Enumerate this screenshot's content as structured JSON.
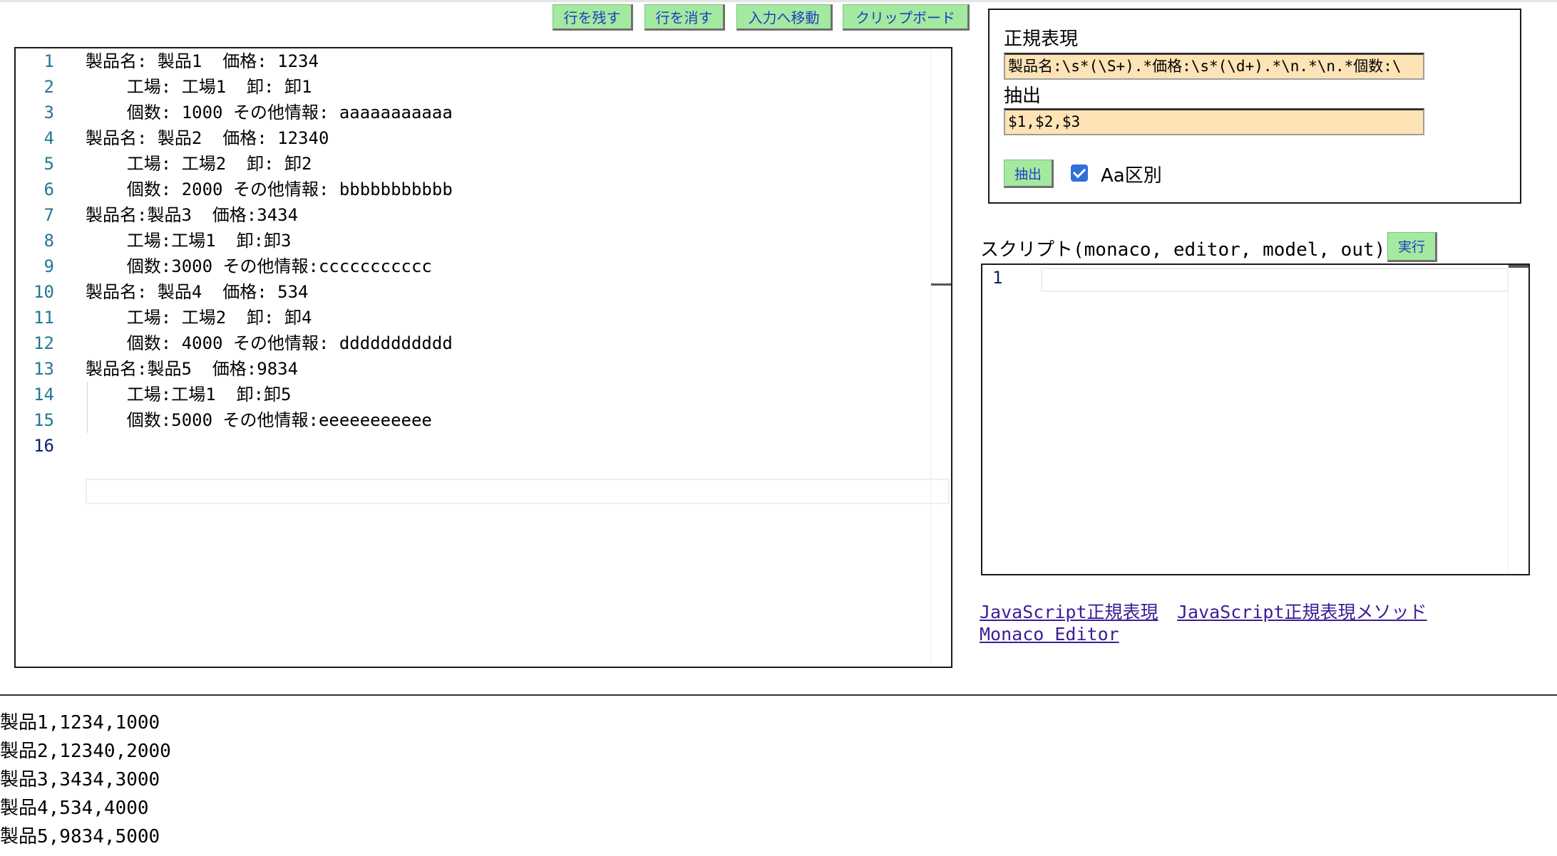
{
  "toolbar": {
    "keep_lines": "行を残す",
    "delete_lines": "行を消す",
    "move_to_input": "入力へ移動",
    "clipboard": "クリップボード"
  },
  "editor": {
    "lines": [
      {
        "num": "1",
        "text": "製品名: 製品1  価格: 1234"
      },
      {
        "num": "2",
        "text": "    工場: 工場1  卸: 卸1"
      },
      {
        "num": "3",
        "text": "    個数: 1000 その他情報: aaaaaaaaaaa"
      },
      {
        "num": "4",
        "text": "製品名: 製品2  価格: 12340"
      },
      {
        "num": "5",
        "text": "    工場: 工場2  卸: 卸2"
      },
      {
        "num": "6",
        "text": "    個数: 2000 その他情報: bbbbbbbbbbb"
      },
      {
        "num": "7",
        "text": "製品名:製品3  価格:3434"
      },
      {
        "num": "8",
        "text": "    工場:工場1  卸:卸3"
      },
      {
        "num": "9",
        "text": "    個数:3000 その他情報:ccccccccccc"
      },
      {
        "num": "10",
        "text": "製品名: 製品4  価格: 534"
      },
      {
        "num": "11",
        "text": "    工場: 工場2  卸: 卸4"
      },
      {
        "num": "12",
        "text": "    個数: 4000 その他情報: ddddddddddd"
      },
      {
        "num": "13",
        "text": "製品名:製品5  価格:9834"
      },
      {
        "num": "14",
        "text": "    工場:工場1  卸:卸5"
      },
      {
        "num": "15",
        "text": "    個数:5000 その他情報:eeeeeeeeeee"
      },
      {
        "num": "16",
        "text": ""
      }
    ]
  },
  "regex": {
    "pattern_label": "正規表現",
    "pattern_value": "製品名:\\s*(\\S+).*価格:\\s*(\\d+).*\\n.*\\n.*個数:\\",
    "extract_label": "抽出",
    "extract_value": "$1,$2,$3",
    "extract_button": "抽出",
    "case_label": "Aa区別",
    "case_checked": true
  },
  "script": {
    "label": "スクリプト(monaco, editor, model, out)",
    "run_button": "実行",
    "line_number": "1"
  },
  "links": {
    "js_regex": "JavaScript正規表現",
    "js_regex_methods": "JavaScript正規表現メソッド",
    "monaco": "Monaco Editor"
  },
  "output": {
    "rows": [
      "製品1,1234,1000",
      "製品2,12340,2000",
      "製品3,3434,3000",
      "製品4,534,4000",
      "製品5,9834,5000"
    ]
  }
}
